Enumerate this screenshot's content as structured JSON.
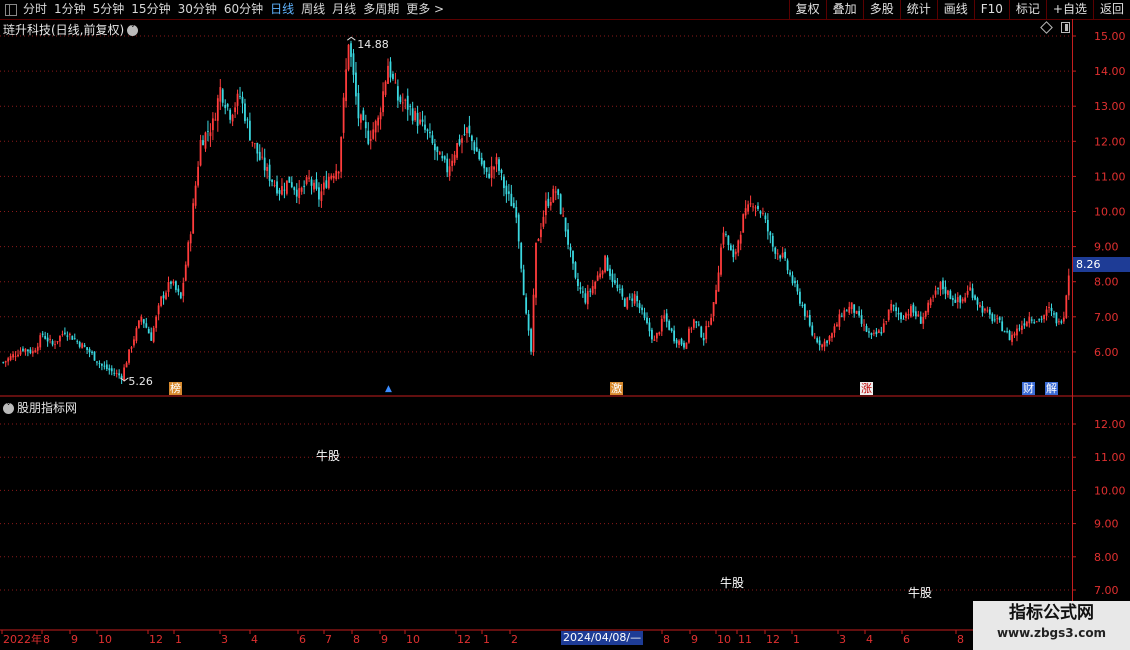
{
  "toolbar": {
    "periods": [
      "分时",
      "1分钟",
      "5分钟",
      "15分钟",
      "30分钟",
      "60分钟",
      "日线",
      "周线",
      "月线",
      "多周期",
      "更多 >"
    ],
    "active_period": "日线",
    "tools": [
      "复权",
      "叠加",
      "多股",
      "统计",
      "画线",
      "F10",
      "标记",
      "+自选",
      "返回"
    ]
  },
  "main_chart": {
    "title": "琏升科技(日线,前复权)",
    "high_label": "14.88",
    "low_label": "5.26",
    "current_price_tag": "8.26",
    "y_ticks": [
      "15.00",
      "14.00",
      "13.00",
      "12.00",
      "11.00",
      "10.00",
      "9.00",
      "8.00",
      "7.00",
      "6.00"
    ],
    "signals": [
      {
        "text": "榜",
        "style": "orange"
      },
      {
        "text": "▲",
        "style": "blue-arrow"
      },
      {
        "text": "激",
        "style": "orange"
      },
      {
        "text": "涨",
        "style": "white"
      },
      {
        "text": "财",
        "style": "blue"
      },
      {
        "text": "解",
        "style": "blue"
      }
    ],
    "colors": {
      "up": "#ff3c3c",
      "down": "#3ad8e0",
      "grid": "#8b1a1a",
      "axis": "#c41e1e"
    }
  },
  "sub_chart": {
    "title": "股朋指标网",
    "y_ticks": [
      "12.00",
      "11.00",
      "10.00",
      "9.00",
      "8.00",
      "7.00"
    ],
    "bull_labels": [
      "牛股",
      "牛股",
      "牛股"
    ]
  },
  "x_axis": {
    "labels": [
      "2022年",
      "8",
      "9",
      "10",
      "12",
      "1",
      "3",
      "4",
      "6",
      "7",
      "8",
      "9",
      "10",
      "12",
      "1",
      "2",
      "8",
      "9",
      "10",
      "11",
      "12",
      "1",
      "3",
      "4",
      "6",
      "8"
    ],
    "cursor_date": "2024/04/08/—"
  },
  "chart_data": {
    "type": "candlestick",
    "title": "琏升科技(日线,前复权)",
    "y_range": [
      5.0,
      15.3
    ],
    "annotations": {
      "high": 14.88,
      "low": 5.26,
      "last": 8.26
    },
    "close_path": [
      [
        0,
        5.7
      ],
      [
        4,
        5.9
      ],
      [
        8,
        6.1
      ],
      [
        12,
        6.0
      ],
      [
        16,
        6.5
      ],
      [
        20,
        6.2
      ],
      [
        25,
        6.6
      ],
      [
        30,
        6.3
      ],
      [
        35,
        6.0
      ],
      [
        40,
        5.6
      ],
      [
        45,
        5.4
      ],
      [
        48,
        5.3
      ],
      [
        52,
        6.2
      ],
      [
        56,
        7.0
      ],
      [
        60,
        6.4
      ],
      [
        64,
        7.5
      ],
      [
        68,
        8.0
      ],
      [
        72,
        7.5
      ],
      [
        76,
        9.5
      ],
      [
        80,
        12.0
      ],
      [
        85,
        12.5
      ],
      [
        88,
        13.5
      ],
      [
        92,
        12.8
      ],
      [
        96,
        13.3
      ],
      [
        100,
        12.2
      ],
      [
        104,
        11.5
      ],
      [
        108,
        11.0
      ],
      [
        112,
        10.6
      ],
      [
        116,
        10.9
      ],
      [
        120,
        10.5
      ],
      [
        124,
        10.9
      ],
      [
        128,
        10.4
      ],
      [
        132,
        11.0
      ],
      [
        136,
        11.3
      ],
      [
        140,
        14.88
      ],
      [
        144,
        12.7
      ],
      [
        148,
        12.1
      ],
      [
        152,
        12.6
      ],
      [
        156,
        14.2
      ],
      [
        160,
        13.2
      ],
      [
        164,
        13.0
      ],
      [
        168,
        12.6
      ],
      [
        172,
        12.2
      ],
      [
        176,
        11.6
      ],
      [
        180,
        11.2
      ],
      [
        184,
        11.9
      ],
      [
        188,
        12.3
      ],
      [
        192,
        11.7
      ],
      [
        196,
        11.0
      ],
      [
        200,
        11.4
      ],
      [
        204,
        10.5
      ],
      [
        208,
        10.0
      ],
      [
        212,
        7.0
      ],
      [
        214,
        6.0
      ],
      [
        216,
        9.0
      ],
      [
        220,
        10.2
      ],
      [
        224,
        10.6
      ],
      [
        228,
        9.5
      ],
      [
        232,
        8.0
      ],
      [
        236,
        7.5
      ],
      [
        240,
        8.0
      ],
      [
        244,
        8.6
      ],
      [
        248,
        7.9
      ],
      [
        252,
        7.4
      ],
      [
        256,
        7.6
      ],
      [
        260,
        6.9
      ],
      [
        264,
        6.3
      ],
      [
        268,
        7.0
      ],
      [
        272,
        6.4
      ],
      [
        276,
        6.2
      ],
      [
        280,
        6.9
      ],
      [
        284,
        6.4
      ],
      [
        288,
        7.3
      ],
      [
        292,
        9.5
      ],
      [
        296,
        8.6
      ],
      [
        300,
        9.8
      ],
      [
        304,
        10.3
      ],
      [
        308,
        9.9
      ],
      [
        312,
        9.0
      ],
      [
        316,
        8.7
      ],
      [
        320,
        8.0
      ],
      [
        324,
        7.3
      ],
      [
        328,
        6.5
      ],
      [
        332,
        6.2
      ],
      [
        336,
        6.5
      ],
      [
        340,
        7.1
      ],
      [
        344,
        7.3
      ],
      [
        348,
        6.8
      ],
      [
        352,
        6.4
      ],
      [
        356,
        6.6
      ],
      [
        360,
        7.3
      ],
      [
        364,
        7.0
      ],
      [
        368,
        7.2
      ],
      [
        372,
        6.9
      ],
      [
        376,
        7.4
      ],
      [
        380,
        7.9
      ],
      [
        384,
        7.6
      ],
      [
        388,
        7.4
      ],
      [
        392,
        7.8
      ],
      [
        396,
        7.3
      ],
      [
        400,
        7.0
      ],
      [
        404,
        6.8
      ],
      [
        408,
        6.4
      ],
      [
        412,
        6.7
      ],
      [
        416,
        7.0
      ],
      [
        420,
        6.9
      ],
      [
        424,
        7.2
      ],
      [
        428,
        6.8
      ],
      [
        430,
        7.1
      ],
      [
        432,
        8.26
      ]
    ]
  }
}
